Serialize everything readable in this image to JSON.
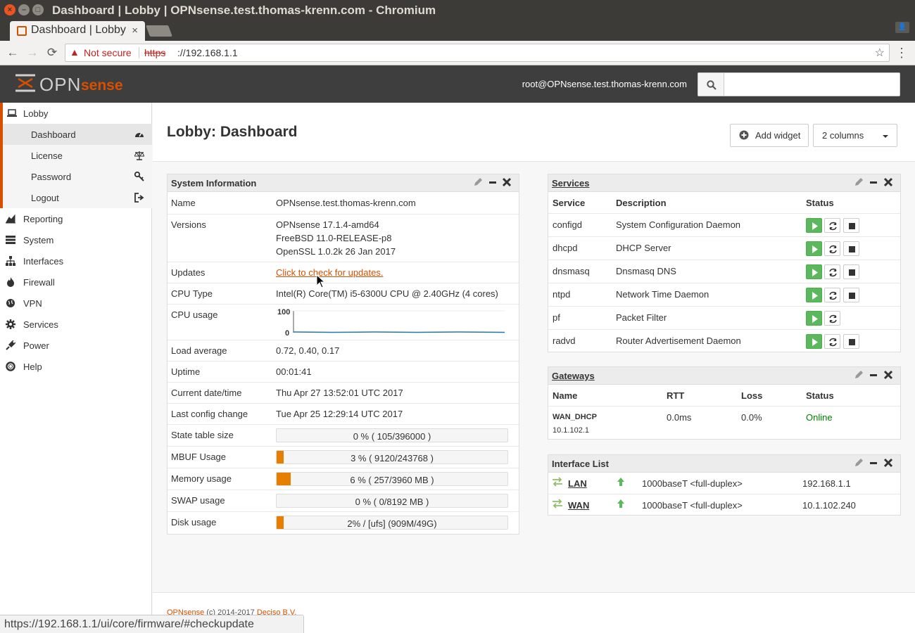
{
  "window": {
    "title": "Dashboard | Lobby | OPNsense.test.thomas-krenn.com - Chromium"
  },
  "tab": {
    "title": "Dashboard | Lobby | OPNsense.test.thomas-krenn.com",
    "close": "×"
  },
  "address": {
    "security_label": "Not secure",
    "scheme": "https",
    "host": "://192.168.1.1"
  },
  "brand": {
    "logo_text": "OPN",
    "logo_sense": "sense",
    "accent": "#d94f00"
  },
  "header": {
    "user": "root@OPNsense.test.thomas-krenn.com",
    "search_placeholder": ""
  },
  "sidebar": {
    "lobby": "Lobby",
    "sub_items": [
      {
        "label": "Dashboard",
        "icon": "dashboard-icon"
      },
      {
        "label": "License",
        "icon": "balance-scale-icon"
      },
      {
        "label": "Password",
        "icon": "key-icon"
      },
      {
        "label": "Logout",
        "icon": "sign-out-icon"
      }
    ],
    "items": [
      {
        "label": "Reporting",
        "icon": "area-chart-icon"
      },
      {
        "label": "System",
        "icon": "server-icon"
      },
      {
        "label": "Interfaces",
        "icon": "sitemap-icon"
      },
      {
        "label": "Firewall",
        "icon": "fire-icon"
      },
      {
        "label": "VPN",
        "icon": "globe-icon"
      },
      {
        "label": "Services",
        "icon": "cog-icon"
      },
      {
        "label": "Power",
        "icon": "plug-icon"
      },
      {
        "label": "Help",
        "icon": "life-ring-icon"
      }
    ]
  },
  "page": {
    "title": "Lobby: Dashboard",
    "add_widget": "Add widget",
    "columns": "2 columns"
  },
  "sysinfo": {
    "title": "System Information",
    "name": {
      "label": "Name",
      "value": "OPNsense.test.thomas-krenn.com"
    },
    "versions": {
      "label": "Versions",
      "lines": [
        "OPNsense 17.1.4-amd64",
        "FreeBSD 11.0-RELEASE-p8",
        "OpenSSL 1.0.2k 26 Jan 2017"
      ]
    },
    "updates": {
      "label": "Updates",
      "link": "Click to check for updates."
    },
    "cpu_type": {
      "label": "CPU Type",
      "value": "Intel(R) Core(TM) i5-6300U CPU @ 2.40GHz (4 cores)"
    },
    "cpu_usage": {
      "label": "CPU usage",
      "max": "100",
      "min": "0"
    },
    "load": {
      "label": "Load average",
      "value": "0.72, 0.40, 0.17"
    },
    "uptime": {
      "label": "Uptime",
      "value": "00:01:41"
    },
    "datetime": {
      "label": "Current date/time",
      "value": "Thu Apr 27 13:52:01 UTC 2017"
    },
    "lastconfig": {
      "label": "Last config change",
      "value": "Tue Apr 25 12:29:14 UTC 2017"
    },
    "bars": [
      {
        "label": "State table size",
        "text": "0 % ( 105/396000 )",
        "fraction": 0.0
      },
      {
        "label": "MBUF Usage",
        "text": "3 % ( 9120/243768 )",
        "fraction": 0.03
      },
      {
        "label": "Memory usage",
        "text": "6 % ( 257/3960 MB )",
        "fraction": 0.06
      },
      {
        "label": "SWAP usage",
        "text": "0 % ( 0/8192 MB )",
        "fraction": 0.0
      },
      {
        "label": "Disk usage",
        "text": "2% / [ufs] (909M/49G)",
        "fraction": 0.02
      }
    ]
  },
  "services": {
    "title": "Services",
    "headers": [
      "Service",
      "Description",
      "Status"
    ],
    "rows": [
      {
        "name": "configd",
        "desc": "System Configuration Daemon",
        "stop": true
      },
      {
        "name": "dhcpd",
        "desc": "DHCP Server",
        "stop": true
      },
      {
        "name": "dnsmasq",
        "desc": "Dnsmasq DNS",
        "stop": true
      },
      {
        "name": "ntpd",
        "desc": "Network Time Daemon",
        "stop": true
      },
      {
        "name": "pf",
        "desc": "Packet Filter",
        "stop": false
      },
      {
        "name": "radvd",
        "desc": "Router Advertisement Daemon",
        "stop": true
      }
    ]
  },
  "gateways": {
    "title": "Gateways",
    "headers": [
      "Name",
      "RTT",
      "Loss",
      "Status"
    ],
    "row": {
      "name": "WAN_DHCP",
      "ip": "10.1.102.1",
      "rtt": "0.0ms",
      "loss": "0.0%",
      "status": "Online",
      "status_color": "#008000"
    }
  },
  "interfaces": {
    "title": "Interface List",
    "rows": [
      {
        "name": "LAN",
        "media": "1000baseT <full-duplex>",
        "ip": "192.168.1.1"
      },
      {
        "name": "WAN",
        "media": "1000baseT <full-duplex>",
        "ip": "10.1.102.240"
      }
    ]
  },
  "footer": {
    "brand": "OPNsense",
    "copy": " (c) 2014-2017 ",
    "company": "Deciso B.V."
  },
  "status_url": "https://192.168.1.1/ui/core/firmware/#checkupdate"
}
